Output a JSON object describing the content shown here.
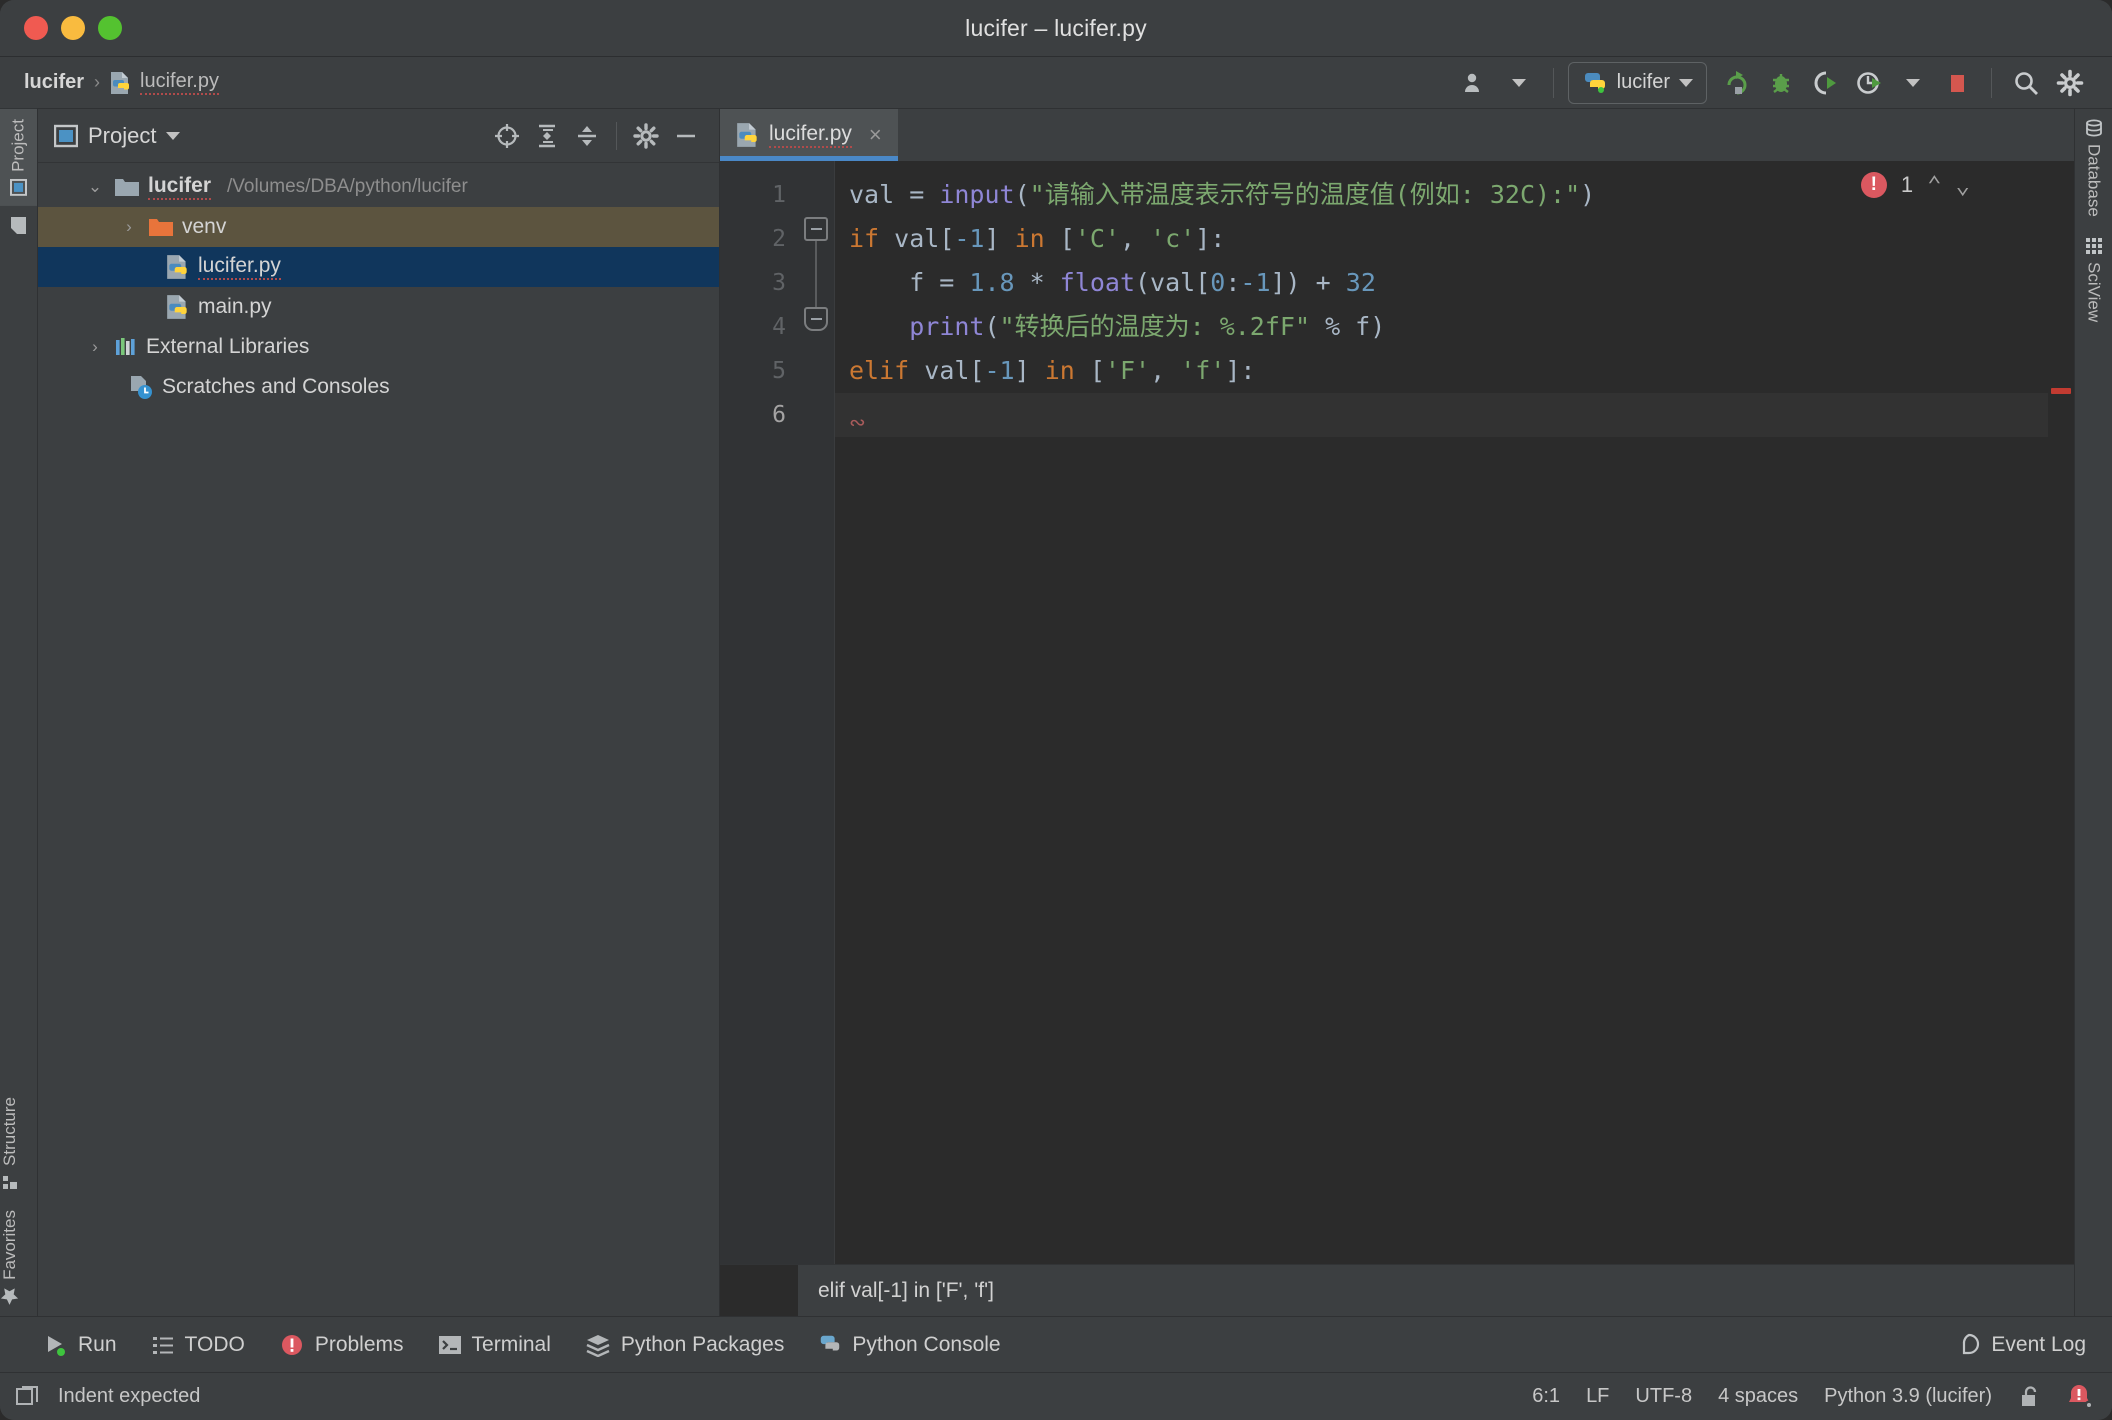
{
  "window": {
    "title": "lucifer – lucifer.py"
  },
  "navbar": {
    "breadcrumbs": [
      {
        "label": "lucifer",
        "icon": ""
      },
      {
        "label": "lucifer.py",
        "icon": "python-file-icon"
      }
    ],
    "separator": "›",
    "run_config": {
      "name": "lucifer",
      "icon": "python-icon"
    },
    "buttons": [
      {
        "name": "user-account-icon",
        "label": ""
      },
      {
        "name": "rerun-icon",
        "label": ""
      },
      {
        "name": "debug-bug-icon",
        "label": ""
      },
      {
        "name": "run-coverage-icon",
        "label": ""
      },
      {
        "name": "profile-icon",
        "label": ""
      },
      {
        "name": "stop-icon",
        "label": ""
      },
      {
        "name": "search-icon",
        "label": ""
      },
      {
        "name": "settings-gear-icon",
        "label": ""
      }
    ]
  },
  "left_stripe": {
    "top": [
      {
        "label": "Project",
        "selected": true,
        "icon": "project-icon"
      },
      {
        "label": "",
        "selected": false,
        "icon": "file-icon"
      }
    ],
    "bottom": [
      {
        "label": "Structure",
        "icon": "structure-icon"
      },
      {
        "label": "Favorites",
        "icon": "star-icon"
      }
    ]
  },
  "right_stripe": {
    "items": [
      {
        "label": "Database",
        "icon": "database-icon"
      },
      {
        "label": "SciView",
        "icon": "grid-icon"
      }
    ]
  },
  "project_panel": {
    "title": "Project",
    "toolbar": [
      {
        "name": "locate-target-icon"
      },
      {
        "name": "expand-all-icon"
      },
      {
        "name": "collapse-all-icon"
      },
      {
        "name": "settings-gear-icon"
      },
      {
        "name": "hide-minimize-icon"
      }
    ],
    "tree": [
      {
        "indent": 0,
        "arrow": "⌄",
        "icon": "folder-icon",
        "name": "lucifer",
        "bold": true,
        "squiggle": true,
        "path": "/Volumes/DBA/python/lucifer",
        "state": "root"
      },
      {
        "indent": 1,
        "arrow": "›",
        "icon": "folder-orange-icon",
        "name": "venv",
        "bold": false,
        "squiggle": false,
        "path": "",
        "state": "highlighted"
      },
      {
        "indent": 2,
        "arrow": "",
        "icon": "python-file-icon",
        "name": "lucifer.py",
        "bold": false,
        "squiggle": true,
        "path": "",
        "state": "selected"
      },
      {
        "indent": 2,
        "arrow": "",
        "icon": "python-file-icon",
        "name": "main.py",
        "bold": false,
        "squiggle": false,
        "path": "",
        "state": ""
      },
      {
        "indent": 0,
        "arrow": "›",
        "icon": "libraries-icon",
        "name": "External Libraries",
        "bold": false,
        "squiggle": false,
        "path": "",
        "state": ""
      },
      {
        "indent": 1,
        "arrow": "",
        "icon": "scratches-icon",
        "name": "Scratches and Consoles",
        "bold": false,
        "squiggle": false,
        "path": "",
        "state": ""
      }
    ]
  },
  "editor": {
    "tabs": [
      {
        "label": "lucifer.py",
        "icon": "python-file-icon",
        "active": true,
        "close": "×"
      }
    ],
    "line_numbers": [
      "1",
      "2",
      "3",
      "4",
      "5",
      "6"
    ],
    "current_line": 6,
    "inspection": {
      "count": "1",
      "up": "⌃",
      "down": "⌄",
      "icon": "error-circle-icon"
    },
    "code_lines": [
      {
        "n": 1,
        "tokens": [
          {
            "t": "val",
            "c": "def"
          },
          {
            "t": " = ",
            "c": "op"
          },
          {
            "t": "input",
            "c": "fn"
          },
          {
            "t": "(",
            "c": "op"
          },
          {
            "t": "\"请输入带温度表示符号的温度值(例如: 32C):\"",
            "c": "str"
          },
          {
            "t": ")",
            "c": "op"
          }
        ]
      },
      {
        "n": 2,
        "tokens": [
          {
            "t": "if",
            "c": "kw"
          },
          {
            "t": " val[",
            "c": "def"
          },
          {
            "t": "-1",
            "c": "num"
          },
          {
            "t": "] ",
            "c": "def"
          },
          {
            "t": "in",
            "c": "kw"
          },
          {
            "t": " [",
            "c": "def"
          },
          {
            "t": "'C'",
            "c": "str"
          },
          {
            "t": ", ",
            "c": "def"
          },
          {
            "t": "'c'",
            "c": "str"
          },
          {
            "t": "]:",
            "c": "def"
          }
        ]
      },
      {
        "n": 3,
        "tokens": [
          {
            "t": "    f = ",
            "c": "def"
          },
          {
            "t": "1.8",
            "c": "num"
          },
          {
            "t": " * ",
            "c": "def"
          },
          {
            "t": "float",
            "c": "fn"
          },
          {
            "t": "(val[",
            "c": "def"
          },
          {
            "t": "0",
            "c": "num"
          },
          {
            "t": ":",
            "c": "def"
          },
          {
            "t": "-1",
            "c": "num"
          },
          {
            "t": "]) + ",
            "c": "def"
          },
          {
            "t": "32",
            "c": "num"
          }
        ]
      },
      {
        "n": 4,
        "tokens": [
          {
            "t": "    ",
            "c": "def"
          },
          {
            "t": "print",
            "c": "fn"
          },
          {
            "t": "(",
            "c": "def"
          },
          {
            "t": "\"转换后的温度为: %.2fF\"",
            "c": "str"
          },
          {
            "t": " % f)",
            "c": "def"
          }
        ]
      },
      {
        "n": 5,
        "tokens": [
          {
            "t": "elif",
            "c": "kw"
          },
          {
            "t": " val[",
            "c": "def"
          },
          {
            "t": "-1",
            "c": "num"
          },
          {
            "t": "] ",
            "c": "def"
          },
          {
            "t": "in",
            "c": "kw"
          },
          {
            "t": " [",
            "c": "def"
          },
          {
            "t": "'F'",
            "c": "str"
          },
          {
            "t": ", ",
            "c": "def"
          },
          {
            "t": "'f'",
            "c": "str"
          },
          {
            "t": "]:",
            "c": "def"
          }
        ]
      },
      {
        "n": 6,
        "tokens": []
      }
    ],
    "breadcrumb_text": "elif val[-1] in ['F', 'f']"
  },
  "bottom_toolbar": {
    "items": [
      {
        "label": "Run",
        "icon": "run-play-icon"
      },
      {
        "label": "TODO",
        "icon": "todo-list-icon"
      },
      {
        "label": "Problems",
        "icon": "problems-error-icon"
      },
      {
        "label": "Terminal",
        "icon": "terminal-icon"
      },
      {
        "label": "Python Packages",
        "icon": "packages-icon"
      },
      {
        "label": "Python Console",
        "icon": "python-console-icon"
      }
    ],
    "event_log": {
      "label": "Event Log",
      "icon": "event-log-icon"
    }
  },
  "statusbar": {
    "message": "Indent expected",
    "message_icon": "memory-indicator-icon",
    "caret_position": "6:1",
    "line_separator": "LF",
    "encoding": "UTF-8",
    "indent": "4 spaces",
    "interpreter": "Python 3.9 (lucifer)",
    "lock_icon": "unlocked-padlock-icon",
    "notification_icon": "notification-error-icon"
  },
  "colors": {
    "chrome": "#3c3f41",
    "editor_bg": "#2b2b2b",
    "gutter_bg": "#313335",
    "accent_blue": "#4a88c7",
    "selection_blue": "#10365c",
    "venv_highlight": "#5c543f",
    "error_red": "#db5860",
    "keyword_orange": "#cc7832",
    "string_green": "#7ca86f",
    "number_blue": "#6897bb",
    "function_purple": "#8f86d6",
    "default_text": "#a9b7c6"
  }
}
